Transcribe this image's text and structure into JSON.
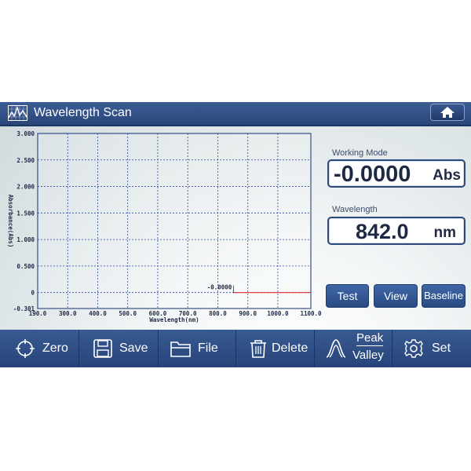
{
  "window": {
    "title": "Wavelength Scan",
    "home_icon": "home-icon",
    "title_icon": "spectrum-icon"
  },
  "readouts": {
    "working_mode_label": "Working Mode",
    "working_mode_value": "-0.0000",
    "working_mode_unit": "Abs",
    "wavelength_label": "Wavelength",
    "wavelength_value": "842.0",
    "wavelength_unit": "nm"
  },
  "side_buttons": {
    "test": "Test",
    "view": "View",
    "baseline": "Baseline"
  },
  "toolbar": {
    "zero": "Zero",
    "save": "Save",
    "file": "File",
    "delete": "Delete",
    "peak": "Peak",
    "valley": "Valley",
    "set": "Set"
  },
  "colors": {
    "accent": "#2a4a80",
    "trace": "#e03030",
    "grid": "#2a4aa0"
  },
  "chart_data": {
    "type": "line",
    "xlabel": "Wavelength(nm)",
    "ylabel": "Absorbance(Abs)",
    "xlim": [
      190.0,
      1100.0
    ],
    "ylim": [
      -0.301,
      3.0
    ],
    "x_ticks": [
      "190.0",
      "300.0",
      "400.0",
      "500.0",
      "600.0",
      "700.0",
      "800.0",
      "900.0",
      "1000.0",
      "1100.0"
    ],
    "y_ticks": [
      {
        "v": 3.0,
        "label": "3.000"
      },
      {
        "v": 2.5,
        "label": "2.500"
      },
      {
        "v": 2.0,
        "label": "2.000"
      },
      {
        "v": 1.5,
        "label": "1.500"
      },
      {
        "v": 1.0,
        "label": "1.000"
      },
      {
        "v": 0.5,
        "label": "0.500"
      },
      {
        "v": 0.0,
        "label": "0"
      },
      {
        "v": -0.301,
        "label": "-0.301"
      }
    ],
    "x_grid": [
      190,
      290,
      390,
      490,
      590,
      690,
      790,
      890,
      990
    ],
    "y_grid": [
      3.0,
      2.5,
      2.0,
      1.5,
      1.0,
      0.5,
      0.0
    ],
    "grid": true,
    "series": [
      {
        "x": [
          842.0,
          1100.0
        ],
        "y": [
          0.0,
          0.0
        ]
      }
    ],
    "annotation": {
      "text": "-0.0000",
      "x": 842.0,
      "y": 0.0
    }
  }
}
